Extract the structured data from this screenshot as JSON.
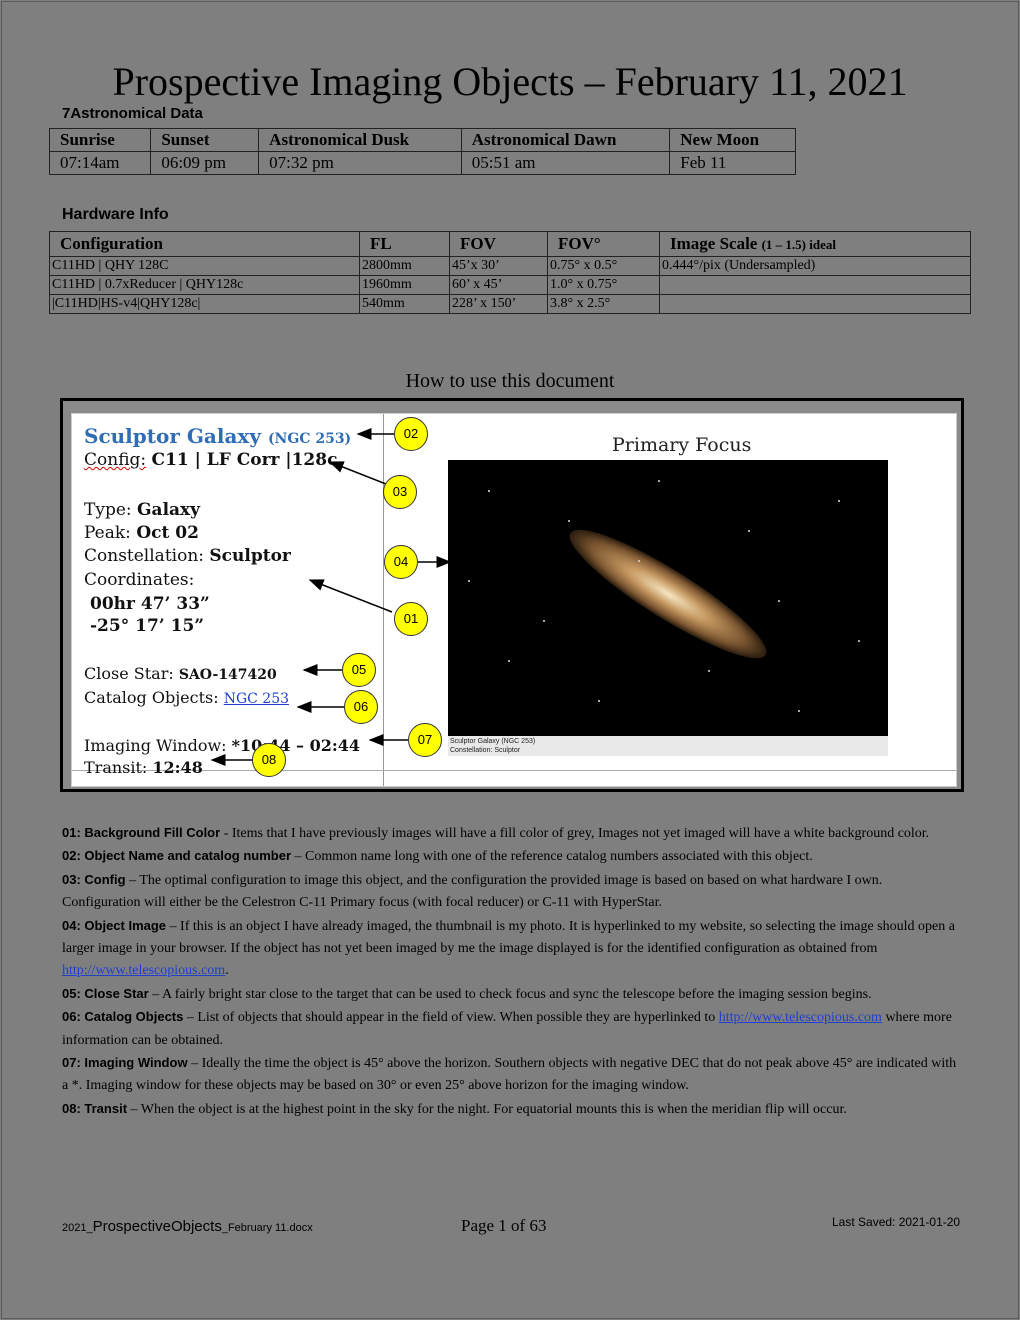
{
  "title": "Prospective Imaging Objects – February 11, 2021",
  "astro_heading": "7Astronomical Data",
  "astro_table": {
    "headers": [
      "Sunrise",
      "Sunset",
      "Astronomical Dusk",
      "Astronomical Dawn",
      "New Moon"
    ],
    "values": [
      "07:14am",
      "06:09 pm",
      "07:32 pm",
      "05:51 am",
      "Feb 11"
    ]
  },
  "hardware": {
    "heading": "Hardware Info",
    "headers": [
      "Configuration",
      "FL",
      "FOV",
      "FOV°",
      "Image Scale"
    ],
    "scale_note": "(1 – 1.5) ideal",
    "rows": [
      [
        "C11HD | QHY 128C",
        "2800mm",
        "45’x 30’",
        "0.75° x 0.5°",
        "0.444°/pix (Undersampled)"
      ],
      [
        "C11HD | 0.7xReducer | QHY128c",
        "1960mm",
        "60’ x 45’",
        "1.0° x 0.75°",
        ""
      ],
      [
        "|C11HD|HS-v4|QHY128c|",
        "540mm",
        "228’ x 150’",
        "3.8° x 2.5°",
        ""
      ]
    ]
  },
  "howto_heading": "How to use this document",
  "figure": {
    "object_name": "Sculptor Galaxy",
    "object_catalog": "(NGC 253)",
    "config_label": "Config:",
    "config_value": "C11 | LF Corr |128c",
    "type_label": "Type:",
    "type_value": "Galaxy",
    "peak_label": "Peak:",
    "peak_value": "Oct 02",
    "constellation_label": "Constellation:",
    "constellation_value": "Sculptor",
    "coordinates_label": "Coordinates:",
    "ra": "00hr 47’ 33”",
    "dec": "-25° 17’ 15”",
    "close_star_label": "Close Star:",
    "close_star_value": "SAO-147420",
    "catalog_objects_label": "Catalog Objects:",
    "catalog_objects_value": "NGC 253",
    "imaging_window_label": "Imaging Window:",
    "imaging_window_value": "*10:44 – 02:44",
    "transit_label": "Transit:",
    "transit_value": "12:48",
    "primary_focus": "Primary Focus",
    "photo_caption_1": "Sculptor Galaxy (NGC 253)",
    "photo_caption_2": "Constellation: Sculptor",
    "markers": [
      "02",
      "03",
      "04",
      "01",
      "05",
      "06",
      "07",
      "08"
    ],
    "marker_color": "#ffff00"
  },
  "legend": [
    {
      "key": "01: Background Fill Color",
      "sep": " - ",
      "text": "Items that I have previously images will have a fill color of grey, Images not yet imaged will have a white background color."
    },
    {
      "key": "02: Object Name and catalog number",
      "sep": " – ",
      "text": "Common name long with one of the reference catalog numbers associated with this object."
    },
    {
      "key": "03: Config",
      "sep": " – ",
      "text": "The optimal configuration to image this object, and the configuration the provided image is based on based on what hardware I own.  Configuration will either be the Celestron C-11 Primary focus (with focal reducer) or C-11 with HyperStar."
    },
    {
      "key": "04: Object Image",
      "sep": " – ",
      "text": "If this is an object I have already imaged, the thumbnail is my photo.  It is hyperlinked to my website, so selecting the image should open a larger image in your browser.  If the object has not yet been imaged by me the image displayed is for the identified configuration as obtained from ",
      "link": "http://www.telescopious.com",
      "after": "."
    },
    {
      "key": "05: Close Star",
      "sep": " – ",
      "text": "A fairly bright star close to the target that can be used to check focus and sync the telescope before the imaging session begins."
    },
    {
      "key": "06: Catalog Objects",
      "sep": " – ",
      "text": "List of objects that should appear in the field of view.  When possible they are hyperlinked to ",
      "link": "http://www.telescopious.com",
      "after": " where more information can be obtained."
    },
    {
      "key": "07: Imaging Window",
      "sep": " – ",
      "text": "Ideally the time the object is 45° above the horizon.  Southern objects with negative DEC that do not peak above 45° are indicated with a *.  Imaging window for these objects may be based on 30° or even 25° above horizon for the imaging window."
    },
    {
      "key": "08: Transit",
      "sep": " – ",
      "text": "When the object is at the highest point in the sky for the night. For equatorial mounts this is when the meridian flip will occur."
    }
  ],
  "footer": {
    "filename_prefix": "2021_",
    "filename_main": "ProspectiveObjects",
    "filename_suffix": "_February 11.docx",
    "page": "Page 1 of 63",
    "saved": "Last Saved: 2021-01-20"
  }
}
